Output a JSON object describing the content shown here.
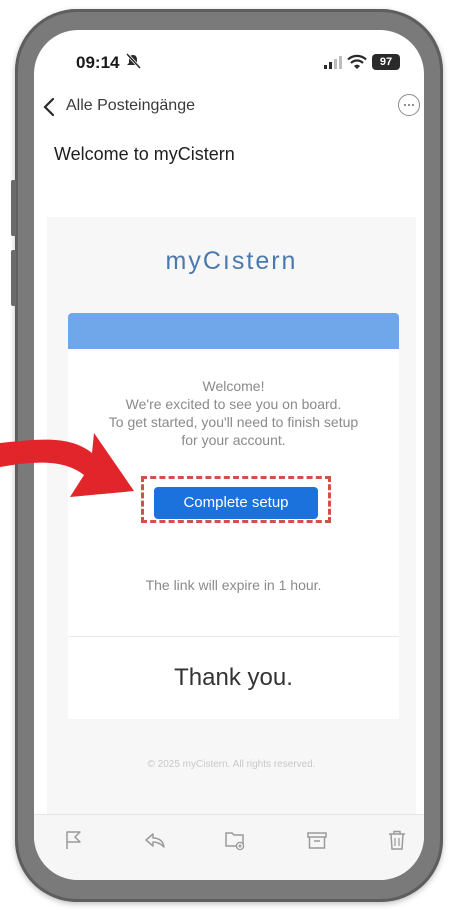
{
  "status_bar": {
    "time": "09:14",
    "battery": "97",
    "icons": [
      "mute-icon",
      "signal-icon",
      "wifi-icon",
      "battery-icon"
    ]
  },
  "nav": {
    "back_label": "Alle Posteingänge",
    "icons": [
      "chevron-left-icon",
      "more-icon"
    ]
  },
  "email": {
    "subject": "Welcome to myCistern",
    "logo": "myCıstern",
    "welcome_lines": [
      "Welcome!",
      "We're excited to see you on board.",
      "To get started, you'll need to finish setup",
      "for your account."
    ],
    "cta_label": "Complete setup",
    "expire_text": "The link will expire in 1 hour.",
    "thanks": "Thank you.",
    "footer": "© 2025 myCistern. All rights reserved."
  },
  "toolbar": {
    "icons": [
      "flag-icon",
      "reply-icon",
      "move-to-folder-icon",
      "archive-icon",
      "trash-icon"
    ]
  },
  "annotation": {
    "arrow_color": "#e1252b",
    "highlight_color": "#d3504a"
  },
  "colors": {
    "accent_bar": "#6fa7ea",
    "button": "#1b72dc",
    "logo": "#4a79ad"
  }
}
